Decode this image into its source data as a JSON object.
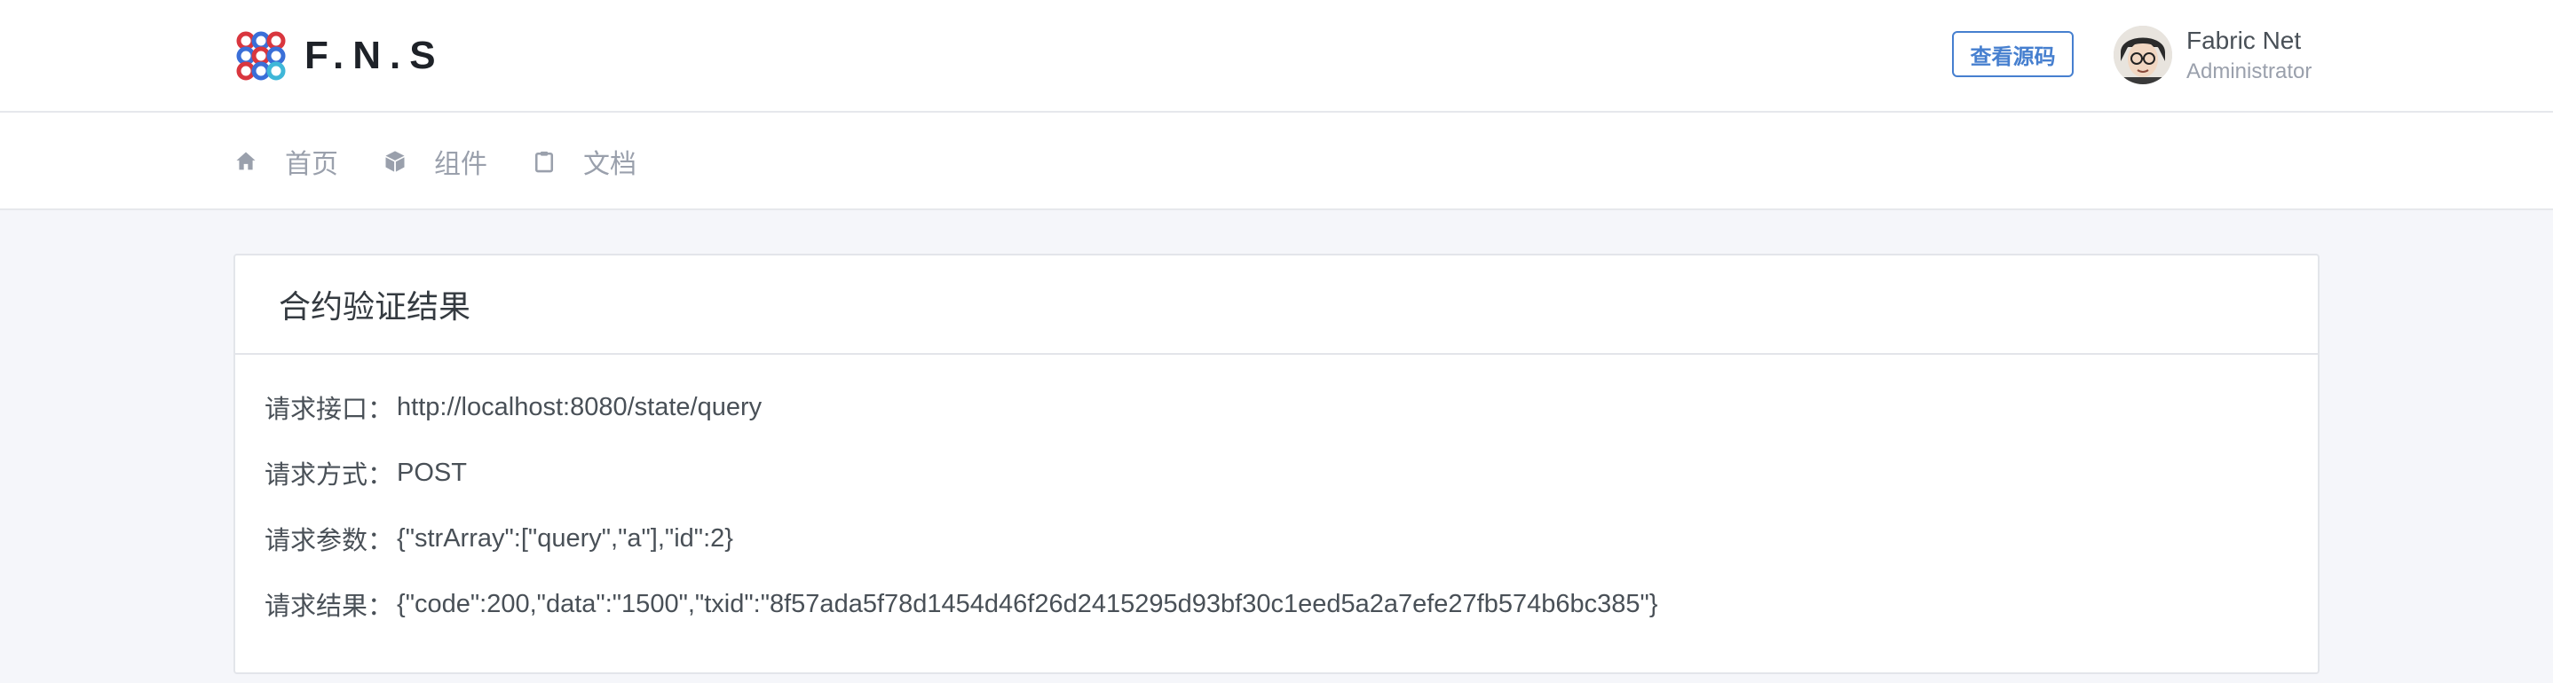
{
  "header": {
    "brand_name": "F.N.S",
    "source_button_label": "查看源码",
    "user": {
      "name": "Fabric Net",
      "role": "Administrator"
    }
  },
  "nav": {
    "items": [
      {
        "label": "首页",
        "icon": "home-icon"
      },
      {
        "label": "组件",
        "icon": "box-icon"
      },
      {
        "label": "文档",
        "icon": "clipboard-icon"
      }
    ]
  },
  "card": {
    "title": "合约验证结果",
    "rows": [
      {
        "label": "请求接口：",
        "value": "http://localhost:8080/state/query"
      },
      {
        "label": "请求方式：",
        "value": "POST"
      },
      {
        "label": "请求参数：",
        "value": "{\"strArray\":[\"query\",\"a\"],\"id\":2}"
      },
      {
        "label": "请求结果：",
        "value": "{\"code\":200,\"data\":\"1500\",\"txid\":\"8f57ada5f78d1454d46f26d2415295d93bf30c1eed5a2a7efe27fb574b6bc385\"}"
      }
    ]
  },
  "colors": {
    "accent": "#467fcf",
    "page_bg": "#f5f6fa",
    "muted_text": "#9aa0ac"
  }
}
